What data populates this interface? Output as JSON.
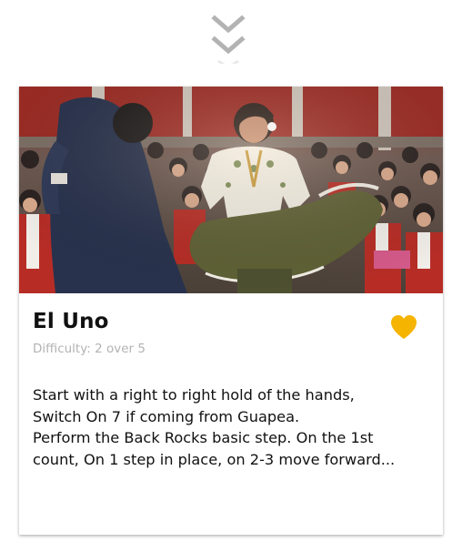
{
  "header": {
    "toggle_icon": "double-chevron-down-icon"
  },
  "card": {
    "image_alt": "Folk dancer in a white embroidered blouse and olive skirt dancing with a partner in front of seated schoolchildren",
    "title": "El Uno",
    "difficulty": "Difficulty: 2 over 5",
    "description": "Start with a right to right hold of the hands, Switch On 7 if coming from Guapea.\nPerform the Back Rocks basic step. On the 1st count, On 1 step in place, on 2-3 move forward...",
    "favorite_icon": "heart-icon",
    "favorite_color": "#F5B400"
  },
  "colors": {
    "chevron": "#B3B3B3",
    "title": "#111111",
    "muted": "#B3B3B3"
  }
}
